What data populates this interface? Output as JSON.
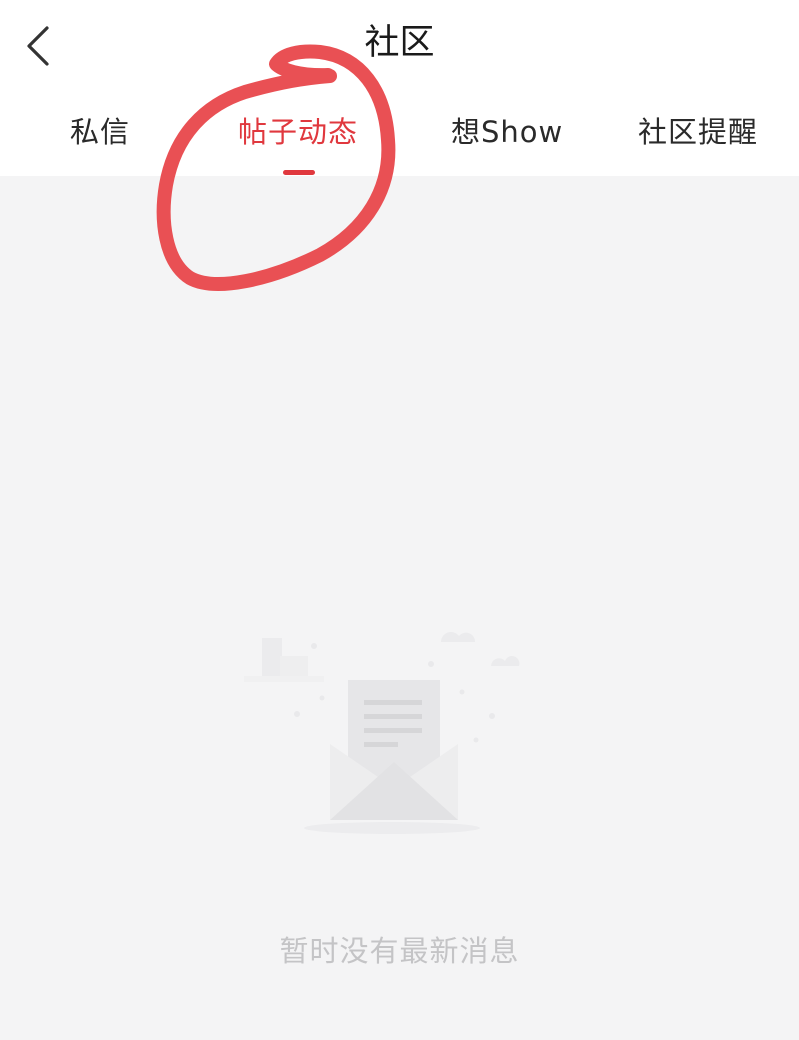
{
  "header": {
    "title": "社区",
    "back_icon": "chevron-left-icon"
  },
  "tabs": [
    {
      "label": "私信",
      "active": false
    },
    {
      "label": "帖子动态",
      "active": true
    },
    {
      "label": "想Show",
      "active": false
    },
    {
      "label": "社区提醒",
      "active": false
    }
  ],
  "empty_state": {
    "icon": "empty-envelope-icon",
    "message": "暂时没有最新消息"
  },
  "colors": {
    "accent": "#e0383e",
    "annotation": "#e8474b",
    "background": "#f4f4f5",
    "header_bg": "#ffffff",
    "empty_text": "#c4c4c6"
  }
}
